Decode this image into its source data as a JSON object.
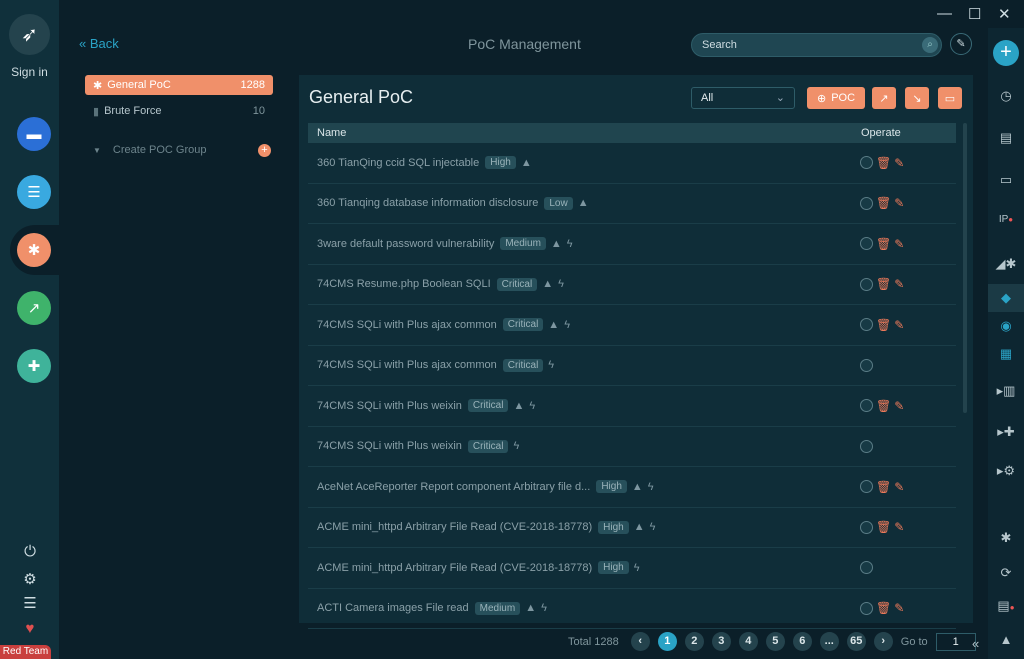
{
  "window": {
    "minimize": "—",
    "maximize": "☐",
    "close": "✕"
  },
  "leftbar": {
    "signin": "Sign in",
    "badge": "Red Team"
  },
  "header": {
    "back": "« Back",
    "title": "PoC Management",
    "search_placeholder": "Search"
  },
  "groups": [
    {
      "label": "General PoC",
      "count": "1288"
    },
    {
      "label": "Brute Force",
      "count": "10"
    }
  ],
  "create_group": "Create POC Group",
  "panel": {
    "title": "General PoC",
    "filter": "All",
    "poc_button": "POC",
    "col_name": "Name",
    "col_operate": "Operate"
  },
  "rows": [
    {
      "name": "360 TianQing ccid SQL injectable",
      "severity": "High",
      "icons": [
        "warn"
      ],
      "full": true
    },
    {
      "name": "360 Tianqing database information disclosure",
      "severity": "Low",
      "icons": [
        "warn"
      ],
      "full": true
    },
    {
      "name": "3ware default password vulnerability",
      "severity": "Medium",
      "icons": [
        "warn",
        "bolt"
      ],
      "full": true
    },
    {
      "name": "74CMS Resume.php Boolean SQLI",
      "severity": "Critical",
      "icons": [
        "warn",
        "bolt"
      ],
      "full": true
    },
    {
      "name": "74CMS SQLi with Plus ajax common",
      "severity": "Critical",
      "icons": [
        "warn",
        "bolt"
      ],
      "full": true
    },
    {
      "name": "74CMS SQLi with Plus ajax common",
      "severity": "Critical",
      "icons": [
        "bolt"
      ],
      "full": false
    },
    {
      "name": "74CMS SQLi with Plus weixin",
      "severity": "Critical",
      "icons": [
        "warn",
        "bolt"
      ],
      "full": true
    },
    {
      "name": "74CMS SQLi with Plus weixin",
      "severity": "Critical",
      "icons": [
        "bolt"
      ],
      "full": false
    },
    {
      "name": "AceNet AceReporter Report component Arbitrary file d...",
      "severity": "High",
      "icons": [
        "warn",
        "bolt"
      ],
      "full": true
    },
    {
      "name": "ACME mini_httpd Arbitrary File Read (CVE-2018-18778)",
      "severity": "High",
      "icons": [
        "warn",
        "bolt"
      ],
      "full": true
    },
    {
      "name": "ACME mini_httpd Arbitrary File Read (CVE-2018-18778)",
      "severity": "High",
      "icons": [
        "bolt"
      ],
      "full": false
    },
    {
      "name": "ACTI Camera images File read",
      "severity": "Medium",
      "icons": [
        "warn",
        "bolt"
      ],
      "full": true
    }
  ],
  "pagination": {
    "total": "Total 1288",
    "pages": [
      "1",
      "2",
      "3",
      "4",
      "5",
      "6",
      "...",
      "65"
    ],
    "current": "1",
    "goto_label": "Go to",
    "goto_value": "1"
  },
  "colors": {
    "accent": "#2aa3c6",
    "orange": "#f0906a"
  }
}
